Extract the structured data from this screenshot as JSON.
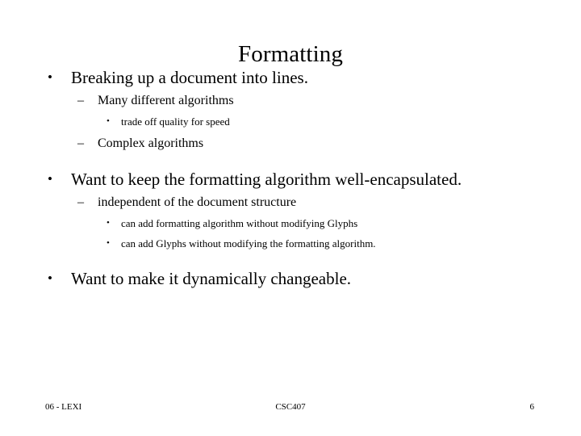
{
  "slide": {
    "title": "Formatting",
    "background_color": "#ffffff",
    "text_color": "#000000",
    "bullets": [
      {
        "level": 1,
        "marker": "•",
        "text": "Breaking up a document into lines."
      },
      {
        "level": 2,
        "marker": "–",
        "text": "Many different algorithms"
      },
      {
        "level": 3,
        "marker": "•",
        "text": "trade off quality for speed"
      },
      {
        "level": 2,
        "marker": "–",
        "text": "Complex algorithms"
      },
      {
        "level": 1,
        "marker": "•",
        "text": "Want to keep the formatting algorithm well-encapsulated."
      },
      {
        "level": 2,
        "marker": "–",
        "text": "independent of the document structure"
      },
      {
        "level": 3,
        "marker": "•",
        "text": "can add formatting algorithm without modifying Glyphs"
      },
      {
        "level": 3,
        "marker": "•",
        "text": "can add Glyphs without modifying the formatting algorithm."
      },
      {
        "level": 1,
        "marker": "•",
        "text": "Want to make it dynamically changeable."
      }
    ],
    "footer": {
      "left": "06 - LEXI",
      "center": "CSC407",
      "page_number": "6"
    }
  }
}
